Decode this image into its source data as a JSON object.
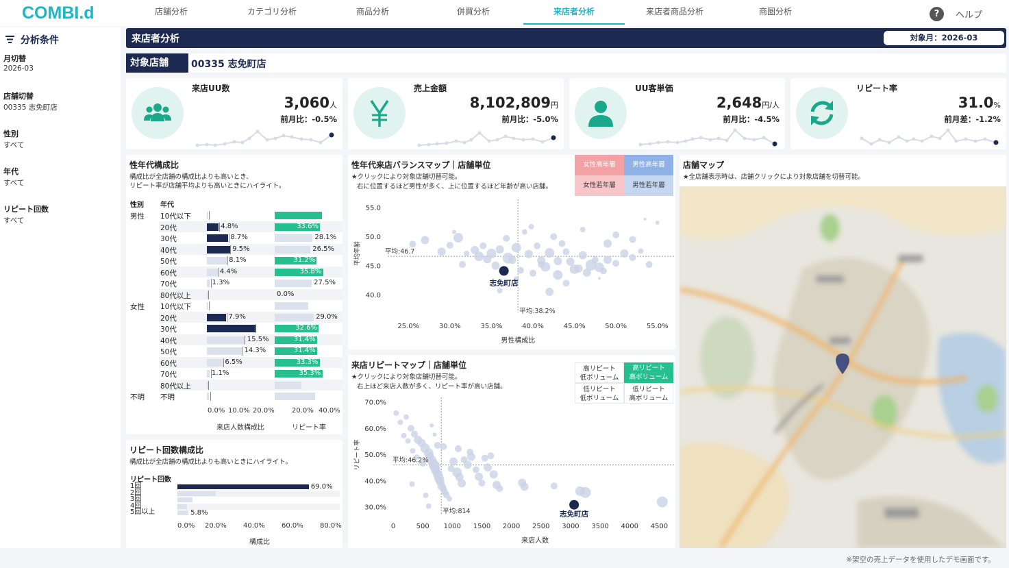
{
  "app": {
    "logo": "COMBI.d",
    "help": "ヘルプ",
    "help_icon": "?"
  },
  "nav": [
    "店舗分析",
    "カテゴリ分析",
    "商品分析",
    "併買分析",
    "来店者分析",
    "来店者商品分析",
    "商圏分析"
  ],
  "sidebar": {
    "title": "分析条件",
    "filters": [
      {
        "label": "月切替",
        "value": "2026-03"
      },
      {
        "label": "店舗切替",
        "value": "00335 志免町店"
      },
      {
        "label": "性別",
        "value": "すべて"
      },
      {
        "label": "年代",
        "value": "すべて"
      },
      {
        "label": "リピート回数",
        "value": "すべて"
      }
    ]
  },
  "page": {
    "title": "来店者分析",
    "month": "対象月：2026-03",
    "store_label": "対象店舗",
    "store_name": "00335 志免町店"
  },
  "kpis": [
    {
      "title": "来店UU数",
      "value": "3,060",
      "unit": "人",
      "sub": "前月比：-0.5%",
      "icon": "people-icon"
    },
    {
      "title": "売上金額",
      "value": "8,102,809",
      "unit": "円",
      "sub": "前月比：-5.0%",
      "icon": "yen-icon"
    },
    {
      "title": "UU客単価",
      "value": "2,648",
      "unit": "円/人",
      "sub": "前月比：-4.5%",
      "icon": "person-icon"
    },
    {
      "title": "リピート率",
      "value": "31.0",
      "unit": "%",
      "sub": "前月差：-1.2%",
      "icon": "refresh-icon"
    }
  ],
  "gender_age": {
    "title": "性年代構成比",
    "desc1": "構成比が全店舗の構成比よりも高いとき、",
    "desc2": "リピート率が店舗平均よりも高いときにハイライト。",
    "col_gender": "性別",
    "col_age": "年代",
    "axis1": [
      "0.0%",
      "10.0%",
      "20.0%"
    ],
    "axis2": [
      "20.0%",
      "40.0%"
    ],
    "xlabel1": "来店人数構成比",
    "xlabel2": "リピート率",
    "rows": [
      {
        "g": "男性",
        "a": "10代以下",
        "c": 0.4,
        "cl": "",
        "ch": false,
        "r": 35.0,
        "rl": "",
        "rh": true
      },
      {
        "g": "",
        "a": "20代",
        "c": 4.8,
        "cl": "4.8%",
        "ch": true,
        "r": 33.6,
        "rl": "33.6%",
        "rh": true
      },
      {
        "g": "",
        "a": "30代",
        "c": 8.7,
        "cl": "8.7%",
        "ch": true,
        "r": 28.1,
        "rl": "28.1%",
        "rh": false
      },
      {
        "g": "",
        "a": "40代",
        "c": 9.5,
        "cl": "9.5%",
        "ch": true,
        "r": 26.5,
        "rl": "26.5%",
        "rh": false
      },
      {
        "g": "",
        "a": "50代",
        "c": 8.1,
        "cl": "8.1%",
        "ch": false,
        "r": 31.2,
        "rl": "31.2%",
        "rh": true
      },
      {
        "g": "",
        "a": "60代",
        "c": 4.4,
        "cl": "4.4%",
        "ch": false,
        "r": 35.8,
        "rl": "35.8%",
        "rh": true
      },
      {
        "g": "",
        "a": "70代",
        "c": 1.3,
        "cl": "1.3%",
        "ch": false,
        "r": 27.5,
        "rl": "27.5%",
        "rh": false
      },
      {
        "g": "",
        "a": "80代以上",
        "c": 0.0,
        "cl": "",
        "ch": false,
        "r": 0.0,
        "rl": "0.0%",
        "rh": false
      },
      {
        "g": "女性",
        "a": "10代以下",
        "c": 0.3,
        "cl": "",
        "ch": false,
        "r": 25.0,
        "rl": "",
        "rh": false
      },
      {
        "g": "",
        "a": "20代",
        "c": 7.9,
        "cl": "7.9%",
        "ch": true,
        "r": 29.0,
        "rl": "29.0%",
        "rh": false
      },
      {
        "g": "",
        "a": "30代",
        "c": 32.6,
        "cl": "",
        "ch": true,
        "r": 32.6,
        "rl": "32.6%",
        "rh": true
      },
      {
        "g": "",
        "a": "40代",
        "c": 15.5,
        "cl": "15.5%",
        "ch": false,
        "r": 31.4,
        "rl": "31.4%",
        "rh": true
      },
      {
        "g": "",
        "a": "50代",
        "c": 14.3,
        "cl": "14.3%",
        "ch": false,
        "r": 31.4,
        "rl": "31.4%",
        "rh": true
      },
      {
        "g": "",
        "a": "60代",
        "c": 6.5,
        "cl": "6.5%",
        "ch": false,
        "r": 33.3,
        "rl": "33.3%",
        "rh": true
      },
      {
        "g": "",
        "a": "70代",
        "c": 1.1,
        "cl": "1.1%",
        "ch": false,
        "r": 35.3,
        "rl": "35.3%",
        "rh": true
      },
      {
        "g": "",
        "a": "80代以上",
        "c": 0.0,
        "cl": "",
        "ch": false,
        "r": 20.0,
        "rl": "",
        "rh": false
      },
      {
        "g": "不明",
        "a": "不明",
        "c": 0.8,
        "cl": "",
        "ch": false,
        "r": 30.0,
        "rl": "",
        "rh": false
      }
    ]
  },
  "repeat_count": {
    "title": "リピート回数構成比",
    "desc": "構成比が全店舗の構成比よりも高いときにハイライト。",
    "col": "リピート回数",
    "xlabel": "構成比",
    "axis": [
      "0.0%",
      "20.0%",
      "40.0%",
      "60.0%",
      "80.0%"
    ],
    "rows": [
      {
        "label": "1回",
        "v": 69.0,
        "t": "69.0%",
        "h": true
      },
      {
        "label": "2回",
        "v": 20.0,
        "t": "",
        "h": false
      },
      {
        "label": "3回",
        "v": 8.0,
        "t": "",
        "h": false
      },
      {
        "label": "4回",
        "v": 5.0,
        "t": "",
        "h": false
      },
      {
        "label": "5回以上",
        "v": 5.8,
        "t": "5.8%",
        "h": false
      }
    ]
  },
  "balance_map": {
    "title": "性年代来店バランスマップ｜店舗単位",
    "desc1": "★クリックにより対象店舗切替可能。",
    "desc2": "右に位置するほど男性が多く、上に位置するほど年齢が高い店舗。",
    "quads": [
      "女性高年層",
      "男性高年層",
      "女性若年層",
      "男性若年層"
    ],
    "avg_x": "平均:38.2%",
    "avg_y": "平均:46.7",
    "store": "志免町店"
  },
  "repeat_map": {
    "title": "来店リピートマップ｜店舗単位",
    "desc1": "★クリックにより対象店舗切替可能。",
    "desc2": "右上ほど来店人数が多く、リピート率が高い店舗。",
    "quads": [
      "高リピート\n低ボリューム",
      "高リピート\n高ボリューム",
      "低リピート\n低ボリューム",
      "低リピート\n高ボリューム"
    ],
    "avg_x": "平均:814",
    "avg_y": "平均:46.2%",
    "store": "志免町店"
  },
  "store_map": {
    "title": "店舗マップ",
    "desc": "★全店舗表示時は、店舗クリックにより対象店舗を切替可能。"
  },
  "footer": "※架空の売上データを使用したデモ画面です。",
  "chart_data": [
    {
      "type": "bar",
      "title": "性年代構成比",
      "xlabel": "来店人数構成比",
      "categories": [
        "男性 10代以下",
        "男性 20代",
        "男性 30代",
        "男性 40代",
        "男性 50代",
        "男性 60代",
        "男性 70代",
        "男性 80代以上",
        "女性 10代以下",
        "女性 20代",
        "女性 30代",
        "女性 40代",
        "女性 50代",
        "女性 60代",
        "女性 70代",
        "女性 80代以上",
        "不明 不明"
      ],
      "values": [
        0.4,
        4.8,
        8.7,
        9.5,
        8.1,
        4.4,
        1.3,
        0.0,
        0.3,
        7.9,
        32.6,
        15.5,
        14.3,
        6.5,
        1.1,
        0.0,
        0.8
      ],
      "xlim": [
        0,
        25
      ]
    },
    {
      "type": "bar",
      "title": "性年代構成比",
      "xlabel": "リピート率",
      "categories": [
        "男性 10代以下",
        "男性 20代",
        "男性 30代",
        "男性 40代",
        "男性 50代",
        "男性 60代",
        "男性 70代",
        "男性 80代以上",
        "女性 10代以下",
        "女性 20代",
        "女性 30代",
        "女性 40代",
        "女性 50代",
        "女性 60代",
        "女性 70代",
        "女性 80代以上",
        "不明 不明"
      ],
      "values": [
        35.0,
        33.6,
        28.1,
        26.5,
        31.2,
        35.8,
        27.5,
        0.0,
        25.0,
        29.0,
        32.6,
        31.4,
        31.4,
        33.3,
        35.3,
        20.0,
        30.0
      ],
      "xlim": [
        0,
        45
      ]
    },
    {
      "type": "bar",
      "title": "リピート回数構成比",
      "xlabel": "構成比",
      "categories": [
        "1回",
        "2回",
        "3回",
        "4回",
        "5回以上"
      ],
      "values": [
        69.0,
        20.0,
        8.0,
        5.0,
        5.8
      ],
      "xlim": [
        0,
        80
      ]
    },
    {
      "type": "scatter",
      "title": "性年代来店バランスマップ｜店舗単位",
      "xlabel": "男性構成比",
      "ylabel": "平均年齢",
      "xlim": [
        22.5,
        57
      ],
      "ylim": [
        38,
        56.5
      ],
      "xticks": [
        "25.0%",
        "30.0%",
        "35.0%",
        "40.0%",
        "45.0%",
        "50.0%",
        "55.0%"
      ],
      "yticks": [
        "40.0",
        "45.0",
        "50.0",
        "55.0"
      ],
      "highlight": {
        "x": 36.5,
        "y": 44.2
      },
      "points": [
        [
          25.5,
          48.8
        ],
        [
          27,
          49.5
        ],
        [
          30,
          48.6
        ],
        [
          31,
          49.9
        ],
        [
          33,
          47.8
        ],
        [
          34,
          48.5
        ],
        [
          35,
          47.2
        ],
        [
          36,
          47.9
        ],
        [
          37,
          46.4
        ],
        [
          38,
          48.2
        ],
        [
          39.5,
          47.1
        ],
        [
          40.5,
          48.5
        ],
        [
          41,
          46
        ],
        [
          42,
          47.3
        ],
        [
          43,
          45.9
        ],
        [
          44,
          47.5
        ],
        [
          45,
          44.5
        ],
        [
          46,
          46.9
        ],
        [
          47,
          45.2
        ],
        [
          48,
          44.8
        ],
        [
          49,
          46.1
        ],
        [
          50,
          45.5
        ],
        [
          51,
          47.2
        ],
        [
          52,
          46.5
        ],
        [
          53,
          47.6
        ],
        [
          54,
          45.3
        ],
        [
          35.5,
          45.1
        ],
        [
          38.5,
          44.3
        ],
        [
          41.5,
          44.9
        ],
        [
          44.5,
          45.8
        ],
        [
          47.5,
          46.1
        ],
        [
          32,
          47.2
        ],
        [
          36.8,
          49.8
        ],
        [
          39,
          50.9
        ],
        [
          42.5,
          50.1
        ],
        [
          46,
          51.3
        ],
        [
          49,
          48.9
        ],
        [
          31.5,
          45.3
        ],
        [
          34.5,
          46.2
        ],
        [
          40,
          43.8
        ],
        [
          43,
          43.5
        ],
        [
          46.5,
          43.9
        ],
        [
          48.5,
          44.2
        ],
        [
          38,
          42.8
        ],
        [
          44,
          42.1
        ],
        [
          36,
          40.8
        ],
        [
          42,
          40.6
        ],
        [
          50,
          50.4
        ],
        [
          52,
          49.6
        ],
        [
          29,
          47.5
        ],
        [
          33.5,
          46.7
        ],
        [
          37.5,
          46.1
        ],
        [
          41,
          45.3
        ],
        [
          45.5,
          44.6
        ],
        [
          48,
          42.9
        ],
        [
          53.5,
          53.1
        ],
        [
          55,
          52.5
        ],
        [
          39.8,
          51.8
        ],
        [
          43.5,
          48.9
        ],
        [
          30.5,
          50.9
        ]
      ],
      "sizes": [
        5,
        6,
        5,
        7,
        6,
        5,
        7,
        6,
        8,
        7,
        6,
        5,
        6,
        7,
        6,
        5,
        7,
        6,
        8,
        7,
        6,
        5,
        6,
        5,
        4,
        5,
        6,
        5,
        7,
        6,
        5,
        4,
        5,
        4,
        5,
        4,
        6,
        5,
        6,
        5,
        7,
        6,
        5,
        4,
        5,
        4,
        6,
        5,
        5,
        6,
        7,
        6,
        5,
        6,
        2,
        2,
        3,
        4,
        5,
        3
      ]
    },
    {
      "type": "scatter",
      "title": "来店リピートマップ｜店舗単位",
      "xlabel": "来店人数",
      "ylabel": "リピート率",
      "xlim": [
        0,
        4750
      ],
      "ylim": [
        27,
        72
      ],
      "xticks": [
        "0",
        "500",
        "1000",
        "1500",
        "2000",
        "2500",
        "3000",
        "3500",
        "4000",
        "4500"
      ],
      "yticks": [
        "30.0%",
        "40.0%",
        "50.0%",
        "60.0%",
        "70.0%"
      ],
      "highlight": {
        "x": 3060,
        "y": 31.0
      },
      "points": [
        [
          50,
          66
        ],
        [
          120,
          62.5
        ],
        [
          220,
          64.5
        ],
        [
          300,
          60.2
        ],
        [
          360,
          58
        ],
        [
          420,
          55.8
        ],
        [
          480,
          54.6
        ],
        [
          540,
          52.6
        ],
        [
          600,
          50.7
        ],
        [
          620,
          49.5
        ],
        [
          650,
          48
        ],
        [
          680,
          46.6
        ],
        [
          700,
          45.8
        ],
        [
          720,
          44.2
        ],
        [
          740,
          43.1
        ],
        [
          760,
          42.2
        ],
        [
          780,
          40.8
        ],
        [
          800,
          39.5
        ],
        [
          820,
          38
        ],
        [
          850,
          37.1
        ],
        [
          870,
          35.9
        ],
        [
          900,
          34.8
        ],
        [
          950,
          33.3
        ],
        [
          980,
          44.8
        ],
        [
          1020,
          47.5
        ],
        [
          1080,
          43.4
        ],
        [
          1120,
          41.6
        ],
        [
          1160,
          39.2
        ],
        [
          1200,
          48.2
        ],
        [
          1260,
          46.3
        ],
        [
          1320,
          49.3
        ],
        [
          1400,
          44.4
        ],
        [
          1450,
          41.7
        ],
        [
          1500,
          39.3
        ],
        [
          1550,
          48.8
        ],
        [
          1600,
          45.2
        ],
        [
          1650,
          49.7
        ],
        [
          1700,
          42.6
        ],
        [
          1750,
          38.6
        ],
        [
          1800,
          37.2
        ],
        [
          2180,
          39.4
        ],
        [
          2220,
          37.9
        ],
        [
          2720,
          38.2
        ],
        [
          3160,
          36.2
        ],
        [
          3250,
          35.7
        ],
        [
          4550,
          32.1
        ],
        [
          550,
          34.6
        ],
        [
          600,
          30.5
        ],
        [
          500,
          46.9
        ],
        [
          400,
          49.2
        ],
        [
          330,
          51.6
        ],
        [
          250,
          55.4
        ],
        [
          180,
          57.4
        ],
        [
          700,
          57.8
        ],
        [
          650,
          61.3
        ],
        [
          320,
          38.9
        ],
        [
          750,
          53.7
        ],
        [
          850,
          53.2
        ],
        [
          1100,
          52.4
        ],
        [
          1300,
          51.1
        ]
      ],
      "sizes": [
        4,
        4,
        4,
        5,
        5,
        6,
        6,
        7,
        7,
        6,
        7,
        7,
        8,
        7,
        6,
        7,
        7,
        6,
        6,
        5,
        5,
        5,
        4,
        5,
        6,
        7,
        6,
        6,
        5,
        6,
        6,
        5,
        6,
        5,
        5,
        6,
        5,
        6,
        6,
        5,
        6,
        6,
        5,
        7,
        8,
        8,
        4,
        4,
        5,
        4,
        4,
        4,
        4,
        3,
        3,
        4,
        5,
        5,
        5,
        5
      ]
    }
  ]
}
